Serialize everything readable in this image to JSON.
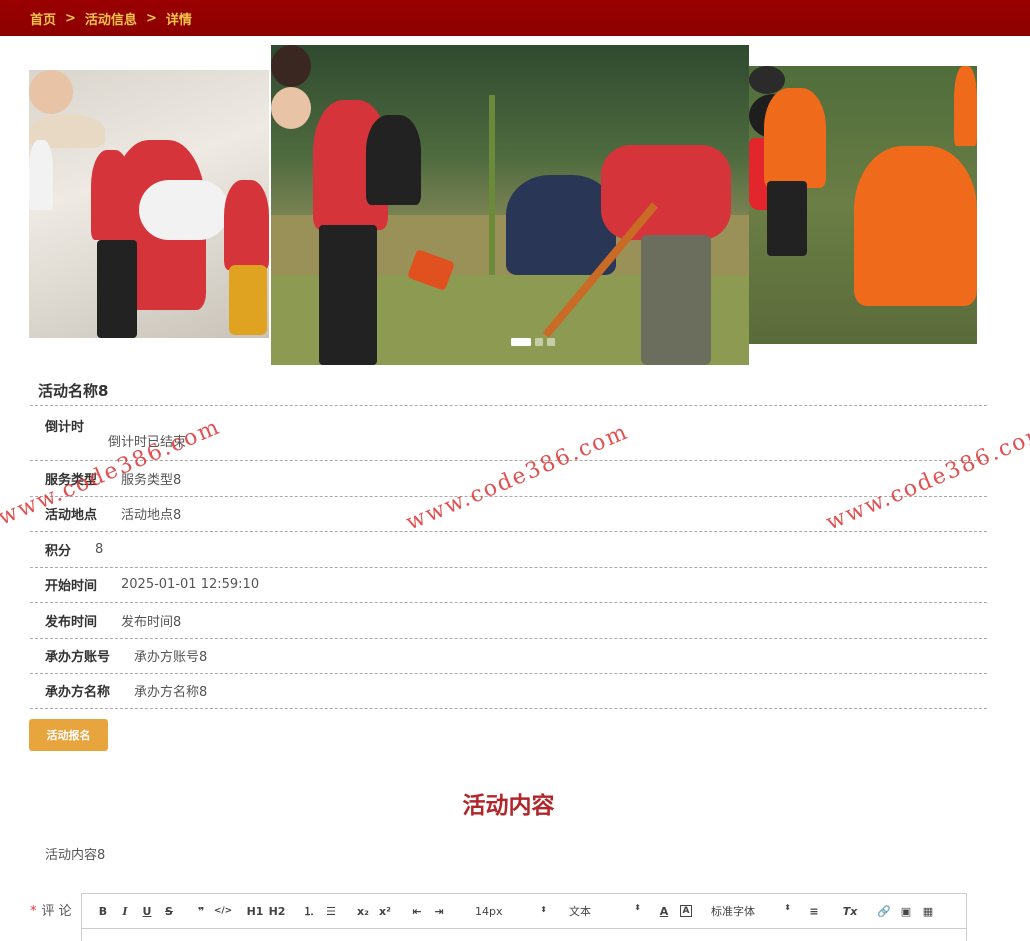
{
  "breadcrumb": {
    "home": "首页",
    "sep": ">",
    "activity_info": "活动信息",
    "detail": "详情"
  },
  "activity": {
    "title": "活动名称8",
    "fields": {
      "countdown_label": "倒计时",
      "countdown_value": "倒计时已结束",
      "service_type_label": "服务类型",
      "service_type_value": "服务类型8",
      "location_label": "活动地点",
      "location_value": "活动地点8",
      "points_label": "积分",
      "points_value": "8",
      "start_time_label": "开始时间",
      "start_time_value": "2025-01-01 12:59:10",
      "publish_time_label": "发布时间",
      "publish_time_value": "发布时间8",
      "org_account_label": "承办方账号",
      "org_account_value": "承办方账号8",
      "org_name_label": "承办方名称",
      "org_name_value": "承办方名称8"
    },
    "signup_button": "活动报名",
    "content_heading": "活动内容",
    "content_text": "活动内容8"
  },
  "watermark": "www.code386.com",
  "comment": {
    "required_mark": "*",
    "label": "评 论",
    "toolbar": {
      "bold": "B",
      "italic": "I",
      "underline": "U",
      "strike": "S",
      "quote": "❞",
      "code": "</>",
      "h1": "H1",
      "h2": "H2",
      "ordered": "⒈",
      "bullet": "☰",
      "sub": "x₂",
      "sup": "x²",
      "outdent": "⇤",
      "indent": "⇥",
      "size": "14px",
      "block": "文本",
      "font": "标准字体",
      "color": "A",
      "bg": "A",
      "align": "≡",
      "clear": "Tx",
      "link": "🔗",
      "image": "▣",
      "video": "▦",
      "select_arrow": "⬍"
    }
  },
  "colors": {
    "topbar": "#9a0000",
    "crumb": "#f3c34a",
    "accent": "#b0262b",
    "button": "#e9a53d"
  }
}
